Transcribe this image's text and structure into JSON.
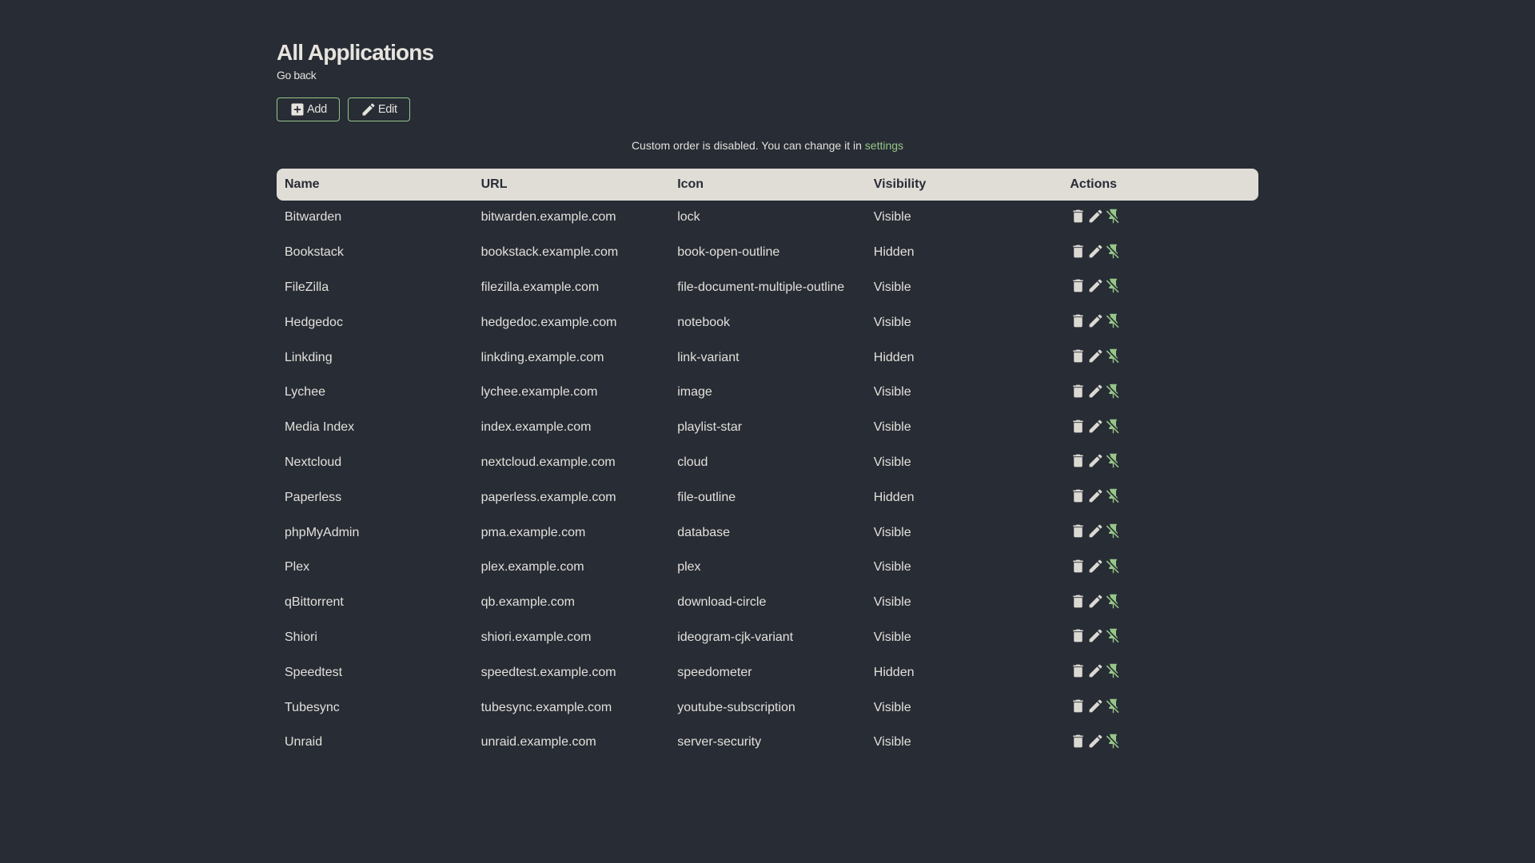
{
  "colors": {
    "background": "#272c35",
    "primary": "#e3e0da",
    "accent": "#97c688",
    "table_header_bg": "#e0ddd7"
  },
  "header": {
    "title": "All Applications",
    "back_label": "Go back"
  },
  "actions": {
    "add_label": "Add",
    "add_icon": "plus-box-icon",
    "edit_label": "Edit",
    "edit_icon": "pencil-icon"
  },
  "notice": {
    "text": "Custom order is disabled. You can change it in",
    "link_label": "settings"
  },
  "table": {
    "columns": [
      "Name",
      "URL",
      "Icon",
      "Visibility",
      "Actions"
    ],
    "row_action_icons": [
      "delete-icon",
      "pencil-icon",
      "pin-off-icon"
    ],
    "rows": [
      {
        "name": "Bitwarden",
        "url": "bitwarden.example.com",
        "icon": "lock",
        "visibility": "Visible"
      },
      {
        "name": "Bookstack",
        "url": "bookstack.example.com",
        "icon": "book-open-outline",
        "visibility": "Hidden"
      },
      {
        "name": "FileZilla",
        "url": "filezilla.example.com",
        "icon": "file-document-multiple-outline",
        "visibility": "Visible"
      },
      {
        "name": "Hedgedoc",
        "url": "hedgedoc.example.com",
        "icon": "notebook",
        "visibility": "Visible"
      },
      {
        "name": "Linkding",
        "url": "linkding.example.com",
        "icon": "link-variant",
        "visibility": "Hidden"
      },
      {
        "name": "Lychee",
        "url": "lychee.example.com",
        "icon": "image",
        "visibility": "Visible"
      },
      {
        "name": "Media Index",
        "url": "index.example.com",
        "icon": "playlist-star",
        "visibility": "Visible"
      },
      {
        "name": "Nextcloud",
        "url": "nextcloud.example.com",
        "icon": "cloud",
        "visibility": "Visible"
      },
      {
        "name": "Paperless",
        "url": "paperless.example.com",
        "icon": "file-outline",
        "visibility": "Hidden"
      },
      {
        "name": "phpMyAdmin",
        "url": "pma.example.com",
        "icon": "database",
        "visibility": "Visible"
      },
      {
        "name": "Plex",
        "url": "plex.example.com",
        "icon": "plex",
        "visibility": "Visible"
      },
      {
        "name": "qBittorrent",
        "url": "qb.example.com",
        "icon": "download-circle",
        "visibility": "Visible"
      },
      {
        "name": "Shiori",
        "url": "shiori.example.com",
        "icon": "ideogram-cjk-variant",
        "visibility": "Visible"
      },
      {
        "name": "Speedtest",
        "url": "speedtest.example.com",
        "icon": "speedometer",
        "visibility": "Hidden"
      },
      {
        "name": "Tubesync",
        "url": "tubesync.example.com",
        "icon": "youtube-subscription",
        "visibility": "Visible"
      },
      {
        "name": "Unraid",
        "url": "unraid.example.com",
        "icon": "server-security",
        "visibility": "Visible"
      }
    ]
  }
}
